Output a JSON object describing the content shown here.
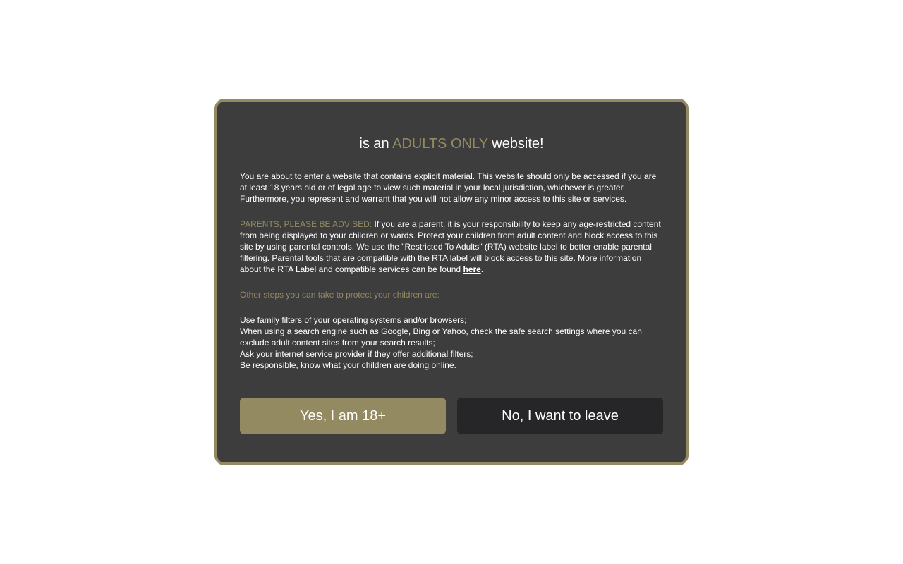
{
  "colors": {
    "accent": "#948a62",
    "modal_bg": "#3d3d3d",
    "leave_button_bg": "#262628",
    "page_bg": "#ffffff"
  },
  "modal": {
    "title_prefix": "is an ",
    "title_accent": "ADULTS ONLY",
    "title_suffix": " website!",
    "intro": "You are about to enter a website that contains explicit material. This website should only be accessed if you are at least 18 years old or of legal age to view such material in your local jurisdiction, whichever is greater. Furthermore, you represent and warrant that you will not allow any minor access to this site or services.",
    "parents_label": "PARENTS, PLEASE BE ADVISED:",
    "parents_text": " If you are a parent, it is your responsibility to keep any age-restricted content from being displayed to your children or wards. Protect your children from adult content and block access to this site by using parental controls. We use the \"Restricted To Adults\" (RTA) website label to better enable parental filtering. Parental tools that are compatible with the RTA label will block access to this site. More information about the RTA Label and compatible services can be found ",
    "here_link": "here",
    "parents_end": ".",
    "steps_heading": "Other steps you can take to protect your children are:",
    "steps": [
      "Use family filters of your operating systems and/or browsers;",
      "When using a search engine such as Google, Bing or Yahoo, check the safe search settings where you can exclude adult content sites from your search results;",
      "Ask your internet service provider if they offer additional filters;",
      "Be responsible, know what your children are doing online."
    ],
    "yes_button": "Yes, I am 18+",
    "no_button": "No, I want to leave"
  }
}
